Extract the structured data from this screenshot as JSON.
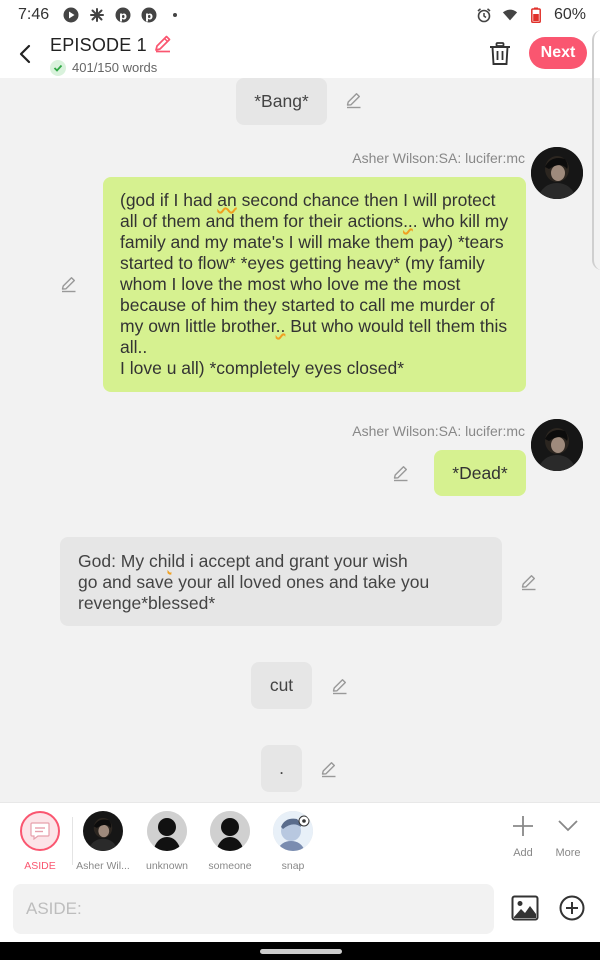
{
  "status_bar": {
    "time": "7:46",
    "battery": "60%",
    "left_icons": [
      "play-circle-icon",
      "pinwheel-icon",
      "pinterest-icon",
      "pinterest-icon",
      "dot-icon"
    ],
    "right_icons": [
      "alarm-icon",
      "wifi-icon",
      "battery-icon"
    ]
  },
  "header": {
    "title": "EPISODE 1",
    "word_count": "401/150 words",
    "next_label": "Next"
  },
  "messages": [
    {
      "type": "aside",
      "text": "*Bang*"
    },
    {
      "type": "character",
      "speaker": "Asher Wilson:SA: lucifer:mc",
      "text_parts": [
        "(god if I had ",
        "an",
        " second chance then I will protect all of them and them for their actions",
        "..",
        ". who kill my family and my mate's I will make them pay) *tears started to flow* *eyes getting heavy* (my family whom I love the most who love me the most because of him they started to call me murder of my own little brother",
        "..",
        " But who would tell them this all..",
        "I love u all) *completely eyes closed*"
      ]
    },
    {
      "type": "character",
      "speaker": "Asher Wilson:SA: lucifer:mc",
      "text": "*Dead*"
    },
    {
      "type": "narration",
      "text_parts": [
        "God: My ch",
        "i",
        "ld i accept and grant your wish",
        "go and save your all loved ones and take you revenge*blessed*"
      ]
    },
    {
      "type": "aside",
      "text": "cut"
    },
    {
      "type": "aside",
      "text": "."
    }
  ],
  "characters": [
    {
      "name": "ASIDE",
      "selected": true
    },
    {
      "name": "Asher Wil..."
    },
    {
      "name": "unknown"
    },
    {
      "name": "someone"
    },
    {
      "name": "snap"
    }
  ],
  "tools": {
    "add_label": "Add",
    "more_label": "More"
  },
  "input": {
    "placeholder": "ASIDE:"
  },
  "colors": {
    "accent": "#fa5670",
    "bubble_green": "#d6f190",
    "bubble_gray": "#e6e6e6",
    "background": "#f2f2f2"
  }
}
